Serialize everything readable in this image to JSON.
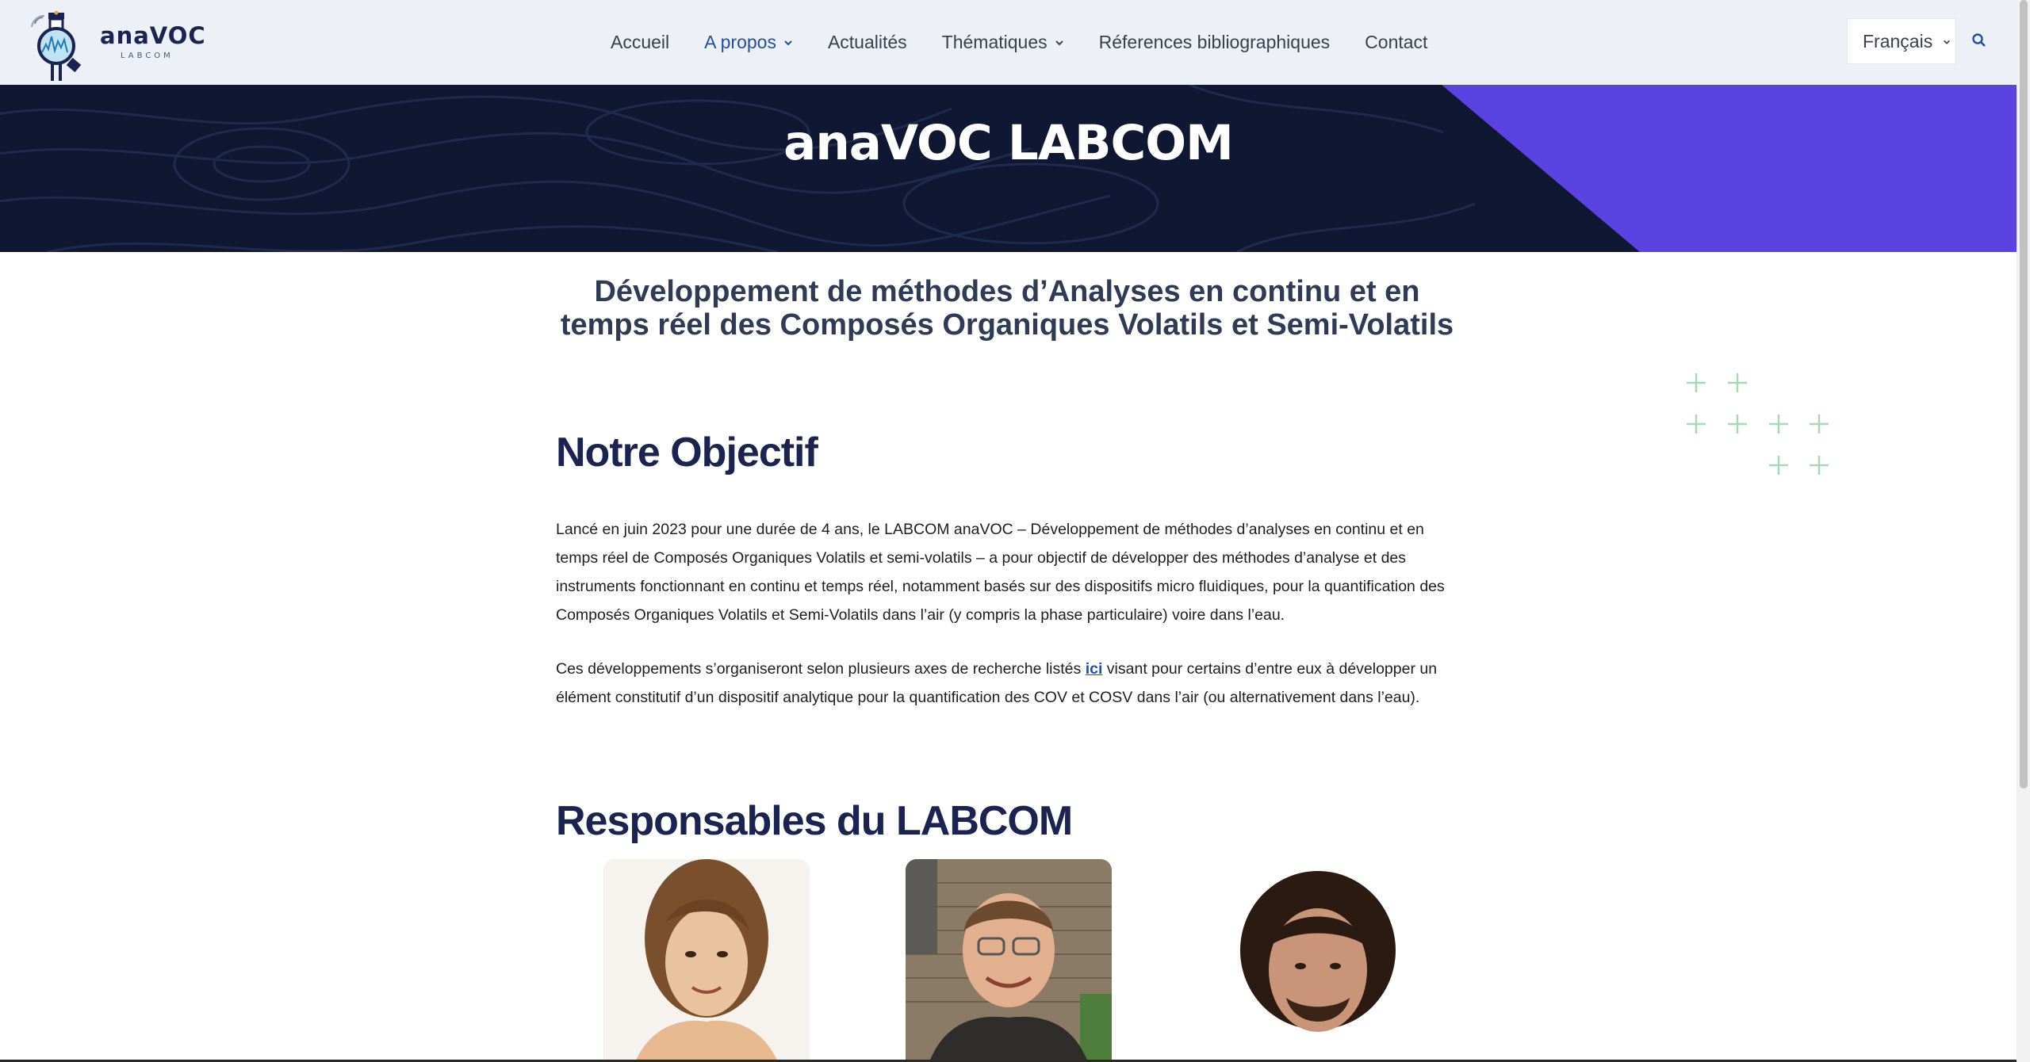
{
  "header": {
    "logo_name": "anaVOC",
    "logo_sub": "LABCOM",
    "nav": [
      {
        "label": "Accueil"
      },
      {
        "label": "A propos"
      },
      {
        "label": "Actualités"
      },
      {
        "label": "Thématiques"
      },
      {
        "label": "Réferences bibliographiques"
      },
      {
        "label": "Contact"
      }
    ],
    "language": "Français"
  },
  "hero": {
    "title": "anaVOC LABCOM"
  },
  "content": {
    "subtitle_line1": "Développement de méthodes d’Analyses en continu et en",
    "subtitle_line2": "temps réel des Composés Organiques Volatils et Semi-Volatils",
    "objective_heading": "Notre Objectif",
    "paragraph1": "Lancé en juin 2023 pour une durée de 4 ans, le LABCOM anaVOC – Développement de méthodes d’analyses en continu et en temps réel de Composés Organiques Volatils et semi-volatils – a pour objectif de développer des méthodes d’analyse et des instruments fonctionnant en continu et temps réel, notamment basés sur des dispositifs micro fluidiques, pour la quantification des Composés Organiques Volatils et Semi-Volatils dans l’air (y compris la phase particulaire) voire dans l’eau.",
    "paragraph2_before": "Ces développements s’organiseront selon plusieurs axes de recherche listés ",
    "paragraph2_link": "ici",
    "paragraph2_after": " visant pour certains d’entre eux à développer un élément constitutif d’un dispositif analytique pour la quantification des COV et COSV dans l’air (ou alternativement dans l’eau).",
    "managers_heading": "Responsables du LABCOM"
  },
  "colors": {
    "nav_active": "#1f4fa8",
    "hero_bg": "#0f1733",
    "hero_accent": "#5a43e0",
    "heading": "#1b2350",
    "plus": "#a6d8b4"
  }
}
